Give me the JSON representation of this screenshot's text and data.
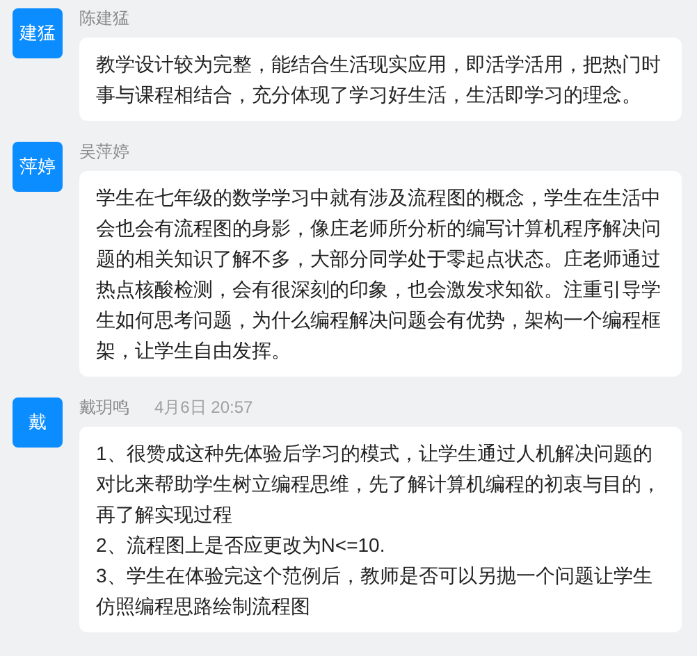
{
  "comments": [
    {
      "avatar": "建猛",
      "name": "陈建猛",
      "paragraphs": [
        "教学设计较为完整，能结合生活现实应用，即活学活用，把热门时事与课程相结合，充分体现了学习好生活，生活即学习的理念。"
      ]
    },
    {
      "avatar": "萍婷",
      "name": "吴萍婷",
      "paragraphs": [
        "学生在七年级的数学学习中就有涉及流程图的概念，学生在生活中会也会有流程图的身影，像庄老师所分析的编写计算机程序解决问题的相关知识了解不多，大部分同学处于零起点状态。庄老师通过热点核酸检测，会有很深刻的印象，也会激发求知欲。注重引导学生如何思考问题，为什么编程解决问题会有优势，架构一个编程框架，让学生自由发挥。"
      ]
    },
    {
      "avatar": "戴",
      "name": "戴玥鸣",
      "time": "4月6日 20:57",
      "paragraphs": [
        "1、很赞成这种先体验后学习的模式，让学生通过人机解决问题的对比来帮助学生树立编程思维，先了解计算机编程的初衷与目的，再了解实现过程",
        "2、流程图上是否应更改为N<=10.",
        "3、学生在体验完这个范例后，教师是否可以另抛一个问题让学生仿照编程思路绘制流程图"
      ]
    }
  ]
}
